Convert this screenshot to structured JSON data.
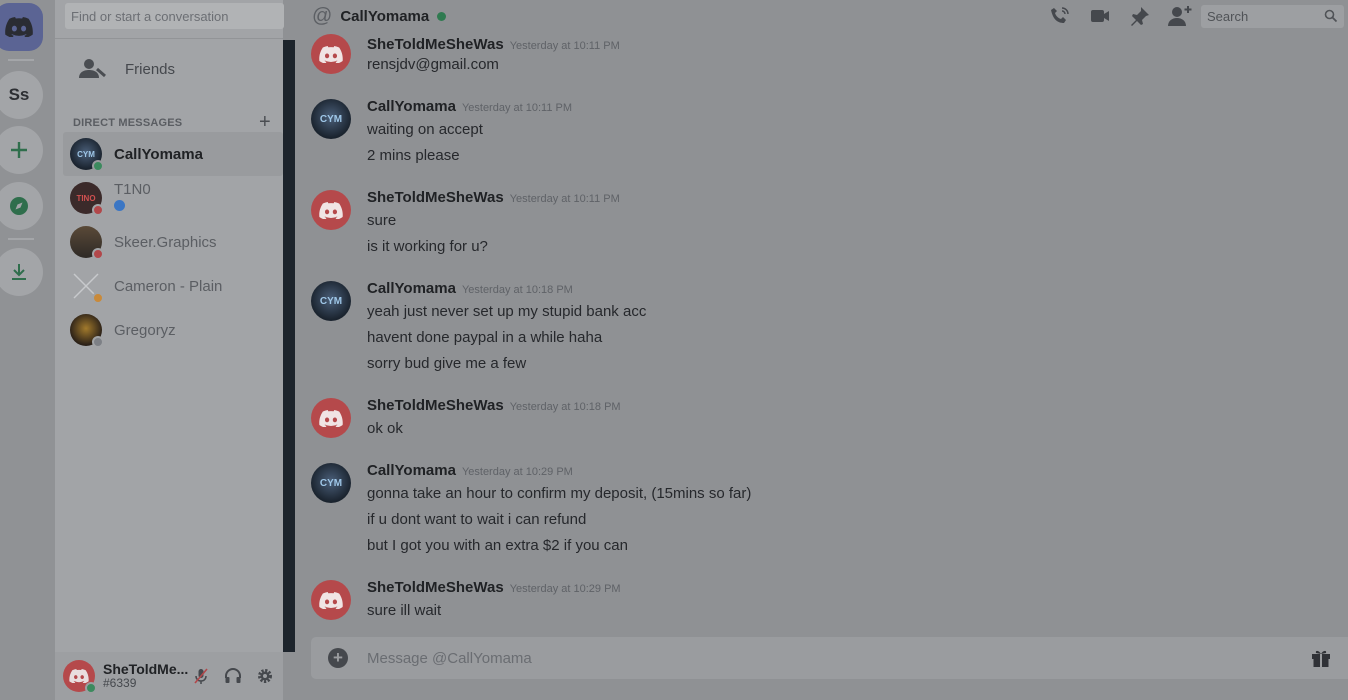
{
  "rail": {
    "server_initials": "Ss"
  },
  "sidebar": {
    "search_placeholder": "Find or start a conversation",
    "friends_label": "Friends",
    "dm_header": "DIRECT MESSAGES",
    "dms": [
      {
        "name": "CallYomama",
        "status": "online",
        "active": true
      },
      {
        "name": "T1N0",
        "status": "dnd",
        "verified": true
      },
      {
        "name": "Skeer.Graphics",
        "status": "dnd"
      },
      {
        "name": "Cameron - Plain",
        "status": "idle"
      },
      {
        "name": "Gregoryz",
        "status": "offline"
      }
    ]
  },
  "user": {
    "name": "SheToldMe...",
    "tag": "#6339"
  },
  "header": {
    "channel": "CallYomama",
    "search_placeholder": "Search"
  },
  "messages": [
    {
      "author": "SheToldMeSheWas",
      "timestamp": "Yesterday at 10:11 PM",
      "avatar": "discord",
      "lines": [
        "rensjdv@gmail.com"
      ]
    },
    {
      "author": "CallYomama",
      "timestamp": "Yesterday at 10:11 PM",
      "avatar": "cym",
      "lines": [
        "waiting on accept",
        "2 mins please"
      ]
    },
    {
      "author": "SheToldMeSheWas",
      "timestamp": "Yesterday at 10:11 PM",
      "avatar": "discord",
      "lines": [
        "sure",
        "is it working for u?"
      ]
    },
    {
      "author": "CallYomama",
      "timestamp": "Yesterday at 10:18 PM",
      "avatar": "cym",
      "lines": [
        "yeah just never set up my stupid bank acc",
        "havent done paypal in a while haha",
        "sorry bud give me a few"
      ]
    },
    {
      "author": "SheToldMeSheWas",
      "timestamp": "Yesterday at 10:18 PM",
      "avatar": "discord",
      "lines": [
        "ok ok"
      ]
    },
    {
      "author": "CallYomama",
      "timestamp": "Yesterday at 10:29 PM",
      "avatar": "cym",
      "lines": [
        "gonna take an hour to confirm my deposit, (15mins so far)",
        "if u dont want to wait i can refund",
        "but I got you with an extra $2 if you can"
      ]
    },
    {
      "author": "SheToldMeSheWas",
      "timestamp": "Yesterday at 10:29 PM",
      "avatar": "discord",
      "lines": [
        "sure ill wait"
      ]
    }
  ],
  "composer": {
    "placeholder": "Message @CallYomama"
  },
  "avatar_text": {
    "cym": "CYM",
    "t1n0": "TINO"
  },
  "colors": {
    "online": "#3c8a5e",
    "dnd": "#b2474a",
    "idle": "#c98a3a",
    "offline": "#7d8086",
    "discord_red": "#b5494b",
    "blurple": "#5b6494"
  }
}
